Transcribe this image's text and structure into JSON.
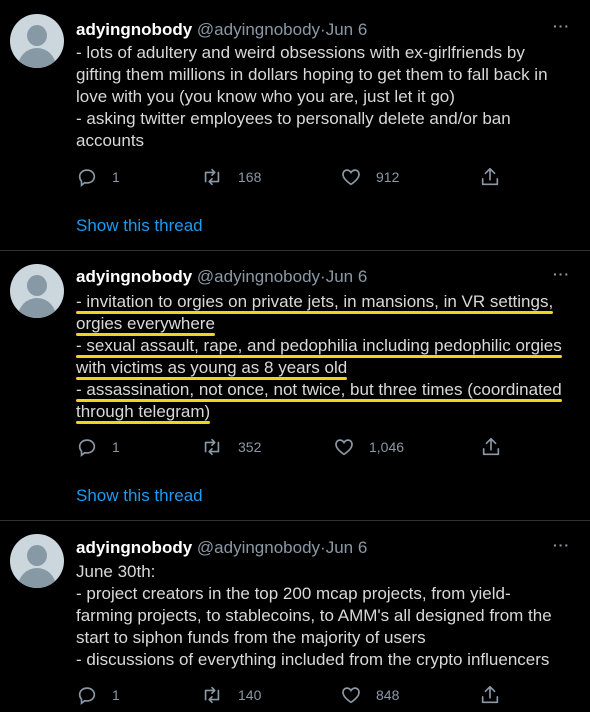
{
  "tweets": [
    {
      "name": "adyingnobody",
      "handle": "@adyingnobody",
      "dot": "·",
      "date": "Jun 6",
      "more": "···",
      "lines": [
        "- lots of adultery and weird obsessions with ex-girlfriends by",
        "gifting them millions in dollars hoping to get them to fall back in",
        "love with you (you know who you are, just let it go)",
        "- asking twitter employees to personally delete and/or ban",
        "accounts"
      ],
      "replies": "1",
      "retweets": "168",
      "likes": "912",
      "show_thread": "Show this thread"
    },
    {
      "name": "adyingnobody",
      "handle": "@adyingnobody",
      "dot": "·",
      "date": "Jun 6",
      "more": "···",
      "lines": [
        "- invitation to orgies on private jets, in mansions, in VR settings,",
        "orgies everywhere",
        "- sexual assault, rape, and pedophilia including pedophilic orgies",
        "with victims as young as 8 years old",
        "- assassination, not once, not twice, but three times (coordinated",
        "through telegram)"
      ],
      "replies": "1",
      "retweets": "352",
      "likes": "1,046",
      "show_thread": "Show this thread"
    },
    {
      "name": "adyingnobody",
      "handle": "@adyingnobody",
      "dot": "·",
      "date": "Jun 6",
      "more": "···",
      "lines": [
        "June 30th:",
        "- project creators in the top 200 mcap projects, from yield-",
        "farming projects, to stablecoins, to AMM's all designed from the",
        "start to siphon funds from the majority of users",
        "- discussions of everything included from the crypto influencers"
      ],
      "replies": "1",
      "retweets": "140",
      "likes": "848"
    }
  ],
  "icons": {
    "reply": "reply-icon",
    "retweet": "retweet-icon",
    "like": "heart-icon",
    "share": "share-icon",
    "more": "more-icon"
  },
  "colors": {
    "background": "#000000",
    "text": "#d9d9d9",
    "secondary": "#8b98a5",
    "link": "#1d9bf0",
    "highlight": "#f4d21f",
    "divider": "#2f3336"
  }
}
